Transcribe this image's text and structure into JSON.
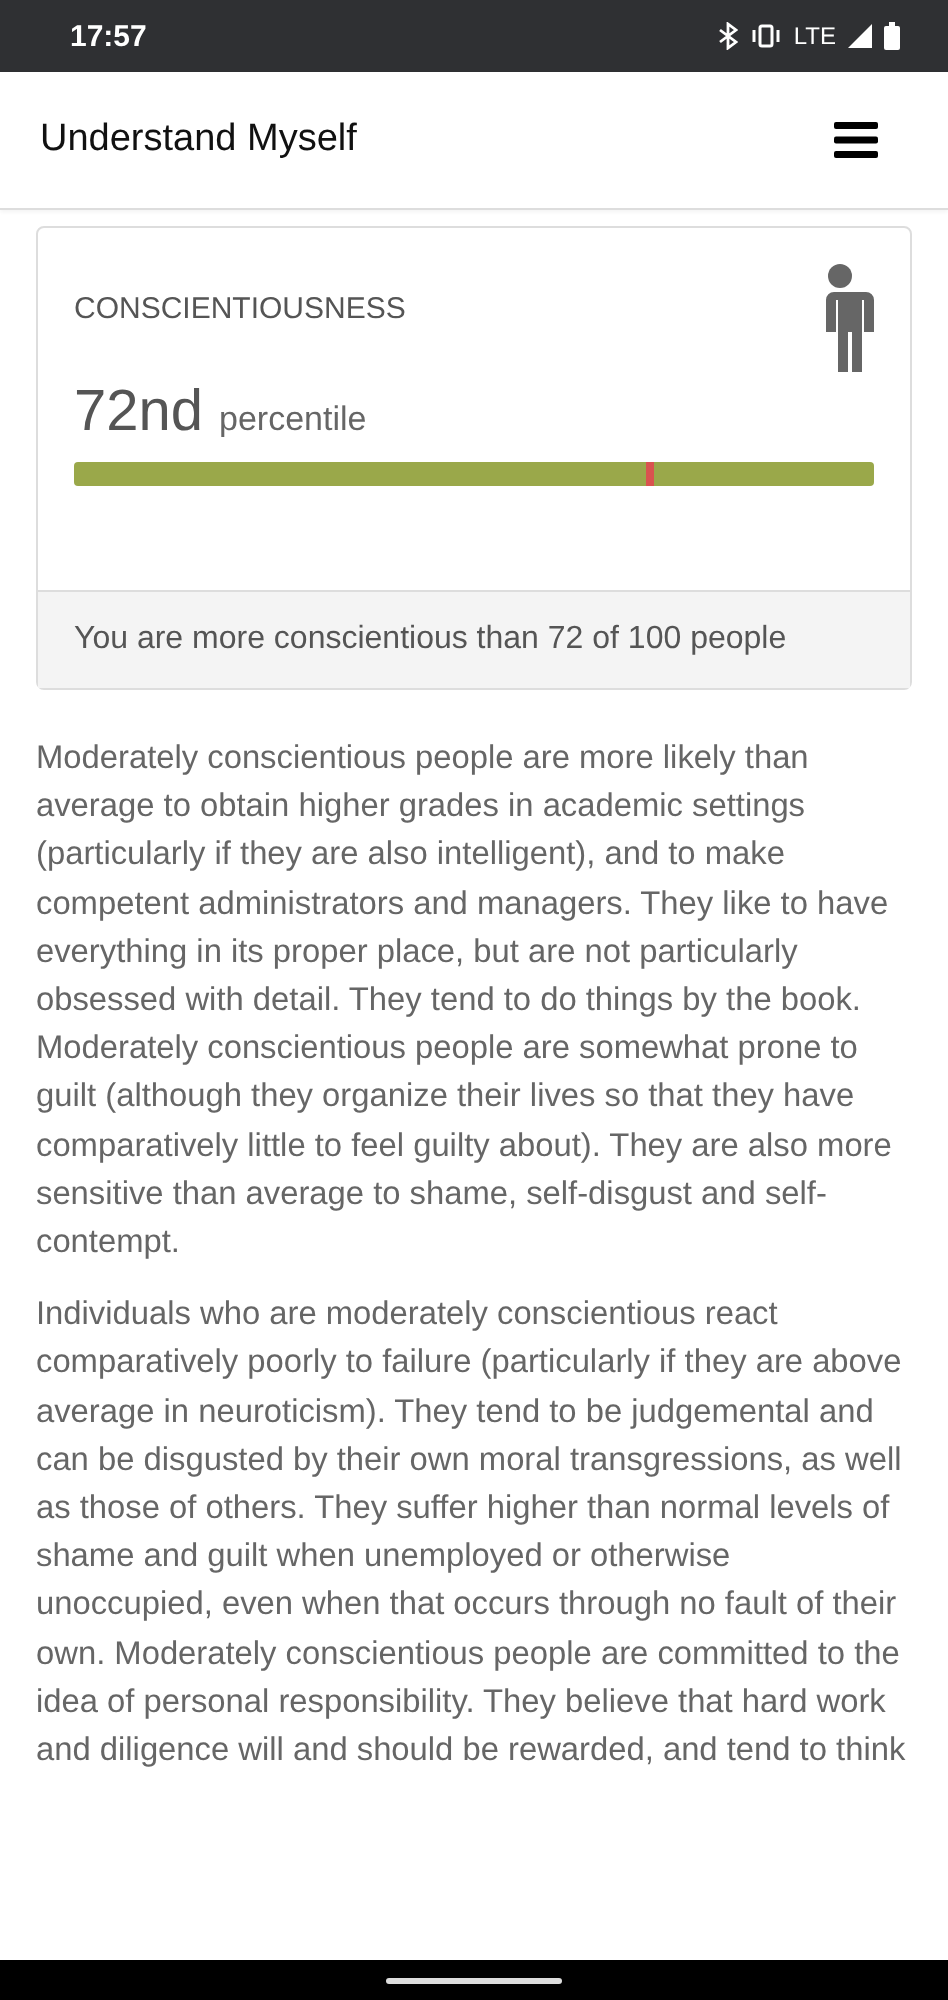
{
  "status_bar": {
    "time": "17:57",
    "network": "LTE"
  },
  "app_bar": {
    "title": "Understand Myself"
  },
  "trait_card": {
    "title": "CONSCIENTIOUSNESS",
    "percentile": "72nd",
    "percentile_label": "percentile",
    "level": 0.72,
    "summary": "You are more conscientious than 72 of 100 people"
  },
  "paragraphs": [
    "Moderately conscientious people are more likely than average to obtain higher grades in academic settings (particularly if they are also intelligent), and to make competent administrators and managers. They like to have everything in its proper place, but are not particularly obsessed with detail. They tend to do things by the book. Moderately conscientious people are somewhat prone to guilt (although they organize their lives so that they have comparatively little to feel guilty about). They are also more sensitive than average to shame, self-disgust and self-contempt.",
    "Individuals who are moderately conscientious react comparatively poorly to failure (particularly if they are above average in neuroticism). They tend to be judgemental and can be disgusted by their own moral transgressions, as well as those of others. They suffer higher than normal levels of shame and guilt when unemployed or otherwise unoccupied, even when that occurs through no fault of their own. Moderately conscientious people are committed to the idea of personal responsibility. They believe that hard work and diligence will and should be rewarded, and tend to think"
  ]
}
